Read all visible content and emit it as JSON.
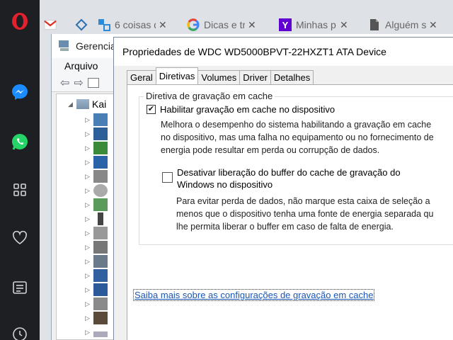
{
  "browser": {
    "tabs": [
      {
        "icon": "gmail-icon",
        "title": ""
      },
      {
        "icon": "diamond-icon",
        "title": ""
      },
      {
        "icon": "link-icon",
        "title": "6 coisas q"
      },
      {
        "icon": "google-icon",
        "title": "Dicas e tr"
      },
      {
        "icon": "yahoo-icon",
        "title": "Minhas p"
      },
      {
        "icon": "document-icon",
        "title": "Alguém s"
      }
    ]
  },
  "device_manager": {
    "title": "Gerencia",
    "menu_file": "Arquivo",
    "tree_root": "Kai"
  },
  "dialog": {
    "title": "Propriedades de WDC WD5000BPVT-22HXZT1 ATA Device",
    "tabs": [
      "Geral",
      "Diretivas",
      "Volumes",
      "Driver",
      "Detalhes"
    ],
    "group_title": "Diretiva de gravação em cache",
    "option1": {
      "label": "Habilitar gravação em cache no dispositivo",
      "checked": true,
      "desc": [
        "Melhora o desempenho do sistema habilitando a gravação em cache",
        "no dispositivo, mas uma falha no equipamento ou no fornecimento de",
        "energia pode resultar em perda ou corrupção de dados."
      ]
    },
    "option2": {
      "label_line1": "Desativar liberação do buffer do cache de gravação do",
      "label_line2": "Windows no dispositivo",
      "checked": false,
      "desc": [
        "Para evitar perda de dados, não marque esta caixa de seleção a",
        "menos que o dispositivo tenha uma fonte de energia separada qu",
        "lhe permita liberar o buffer em caso de falta de energia."
      ]
    },
    "link": "Saiba mais sobre as configurações de gravação em cache"
  },
  "colors": {
    "opera_red": "#e3202d",
    "messenger_blue": "#1a8cff",
    "whatsapp_green": "#25d366",
    "link_blue": "#1a56b5"
  }
}
